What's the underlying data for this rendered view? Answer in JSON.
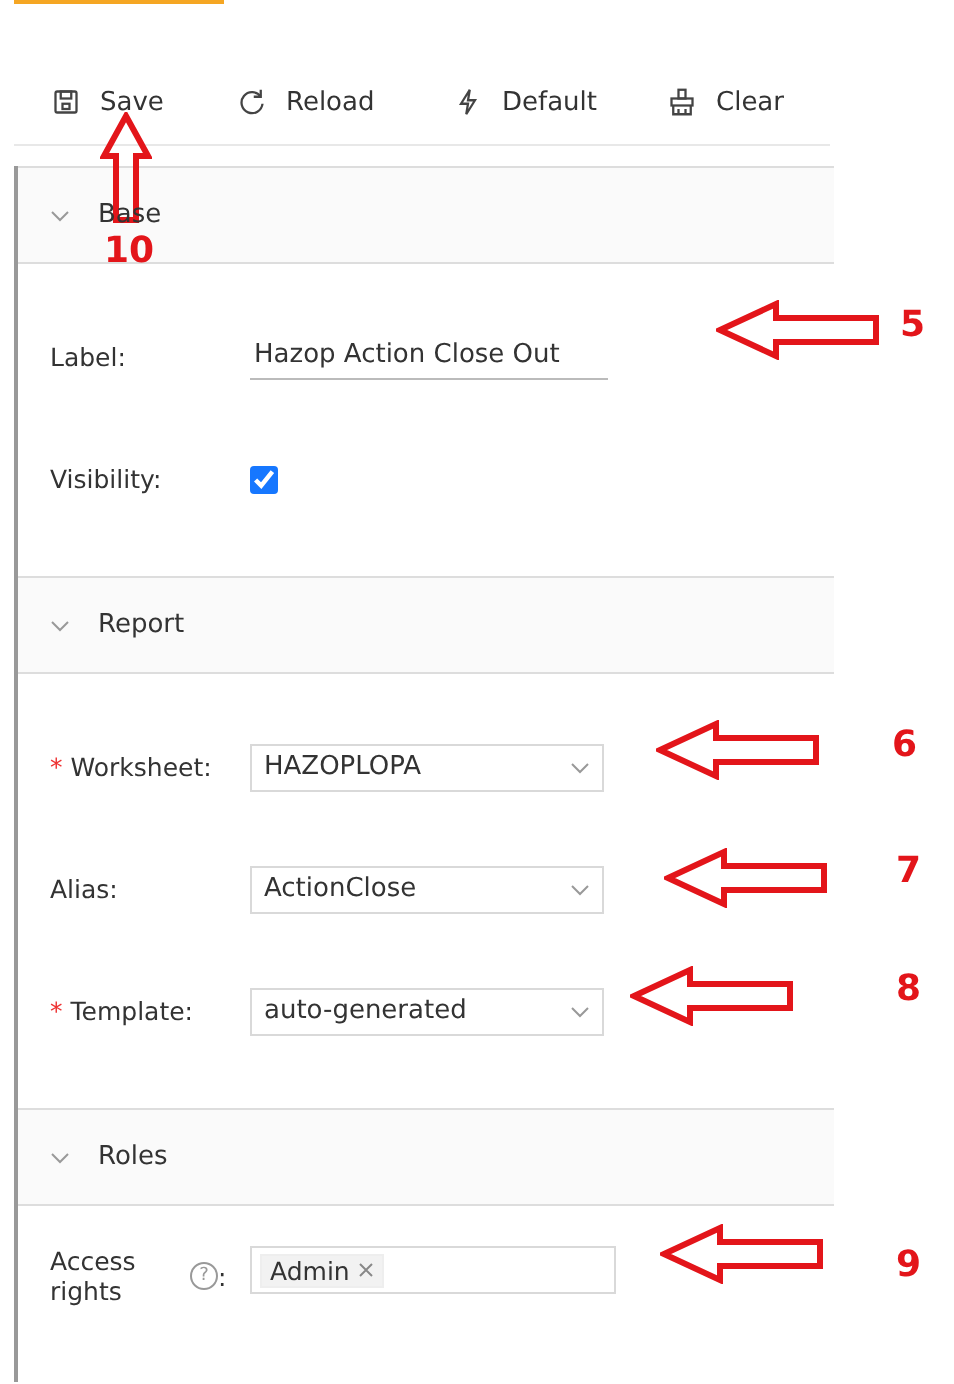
{
  "toolbar": [
    {
      "kind": "save",
      "label": "Save"
    },
    {
      "kind": "reload",
      "label": "Reload"
    },
    {
      "kind": "default",
      "label": "Default"
    },
    {
      "kind": "clear",
      "label": "Clear"
    }
  ],
  "sections": [
    {
      "title": "Base",
      "expanded": true,
      "fields": [
        {
          "kind": "text",
          "label": "Label:",
          "value": "Hazop Action Close Out"
        },
        {
          "kind": "checkbox",
          "label": "Visibility:",
          "checked": true
        }
      ]
    },
    {
      "title": "Report",
      "expanded": true,
      "fields": [
        {
          "kind": "select",
          "label": "Worksheet:",
          "required_mark": "*",
          "value": "HAZOPLOPA"
        },
        {
          "kind": "select",
          "label": "Alias:",
          "value": "ActionClose"
        },
        {
          "kind": "select",
          "label": "Template:",
          "required_mark": "*",
          "value": "auto-generated"
        }
      ]
    },
    {
      "title": "Roles",
      "expanded": true,
      "fields": [
        {
          "kind": "tags",
          "label": "Access rights",
          "help": "?",
          "colon": ":",
          "tags": [
            "Admin"
          ]
        }
      ]
    }
  ],
  "annotations": [
    {
      "kind": "up",
      "number": "10"
    },
    {
      "kind": "left",
      "number": "5"
    },
    {
      "kind": "left",
      "number": "6"
    },
    {
      "kind": "left",
      "number": "7"
    },
    {
      "kind": "left",
      "number": "8"
    },
    {
      "kind": "left",
      "number": "9"
    }
  ]
}
